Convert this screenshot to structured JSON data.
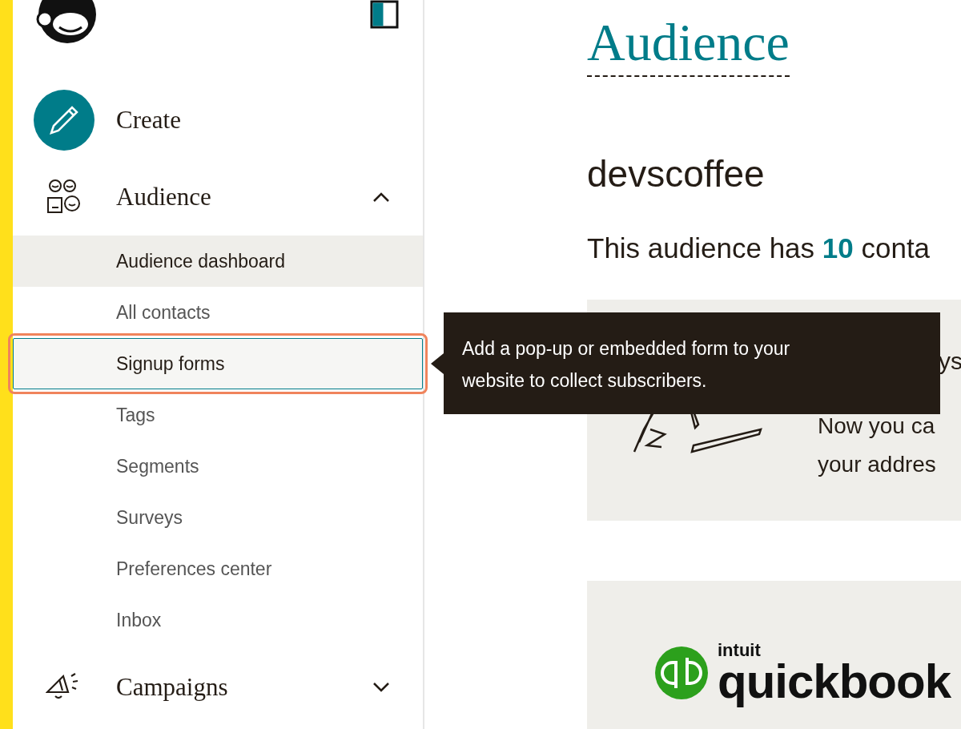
{
  "sidebar": {
    "nav": [
      {
        "label": "Create",
        "kind": "create"
      },
      {
        "label": "Audience",
        "kind": "audience",
        "expanded": true,
        "children": [
          {
            "label": "Audience dashboard",
            "selected": true,
            "highlighted": false
          },
          {
            "label": "All contacts",
            "selected": false,
            "highlighted": false
          },
          {
            "label": "Signup forms",
            "selected": false,
            "highlighted": true
          },
          {
            "label": "Tags",
            "selected": false,
            "highlighted": false
          },
          {
            "label": "Segments",
            "selected": false,
            "highlighted": false
          },
          {
            "label": "Surveys",
            "selected": false,
            "highlighted": false
          },
          {
            "label": "Preferences center",
            "selected": false,
            "highlighted": false
          },
          {
            "label": "Inbox",
            "selected": false,
            "highlighted": false
          }
        ]
      },
      {
        "label": "Campaigns",
        "kind": "campaigns",
        "expanded": false
      }
    ]
  },
  "tooltip": {
    "text": "Add a pop-up or embedded form to your website to collect subscribers."
  },
  "main": {
    "heading": "Audience",
    "audience_name": "devscoffee",
    "summary": "This audience has **10** conta",
    "cards": [
      {
        "kind": "info",
        "title": "ys",
        "lines": [
          "Now you ca",
          "your addres"
        ]
      },
      {
        "kind": "partner",
        "logo_small": "intuit",
        "logo_large": "quickbook"
      }
    ]
  }
}
